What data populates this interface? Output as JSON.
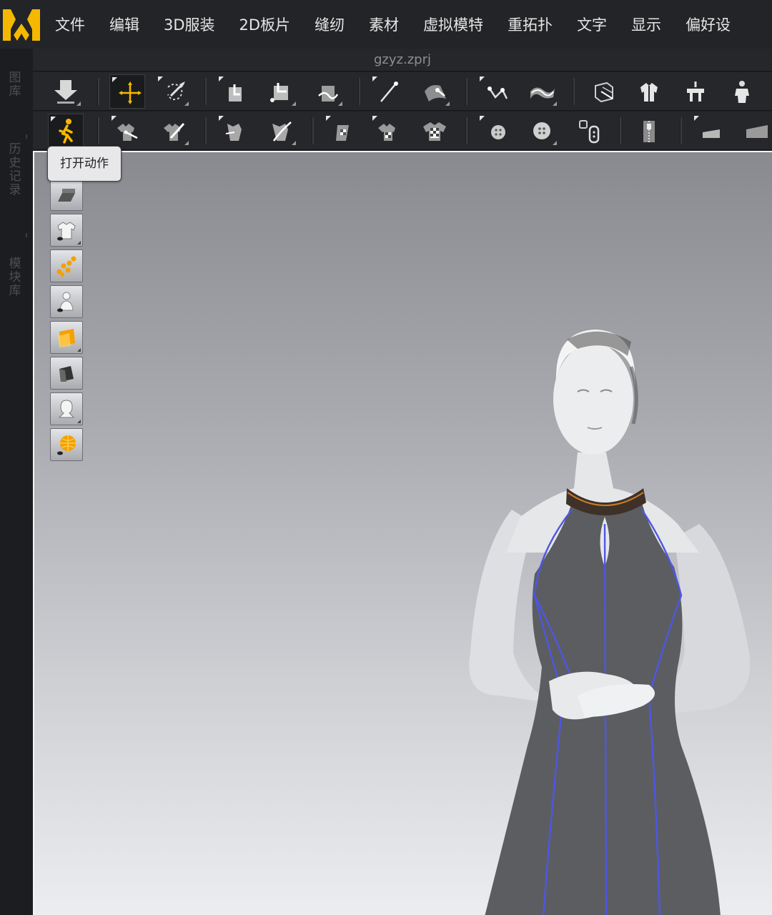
{
  "app": {
    "logo_icon": "marvelous-designer-logo-icon",
    "accent_color": "#f5b800",
    "file_name": "gzyz.zprj"
  },
  "menu": [
    {
      "label": "文件"
    },
    {
      "label": "编辑"
    },
    {
      "label": "3D服装"
    },
    {
      "label": "2D板片"
    },
    {
      "label": "缝纫"
    },
    {
      "label": "素材"
    },
    {
      "label": "虚拟模特"
    },
    {
      "label": "重拓扑"
    },
    {
      "label": "文字"
    },
    {
      "label": "显示"
    },
    {
      "label": "偏好设"
    }
  ],
  "side_tabs": [
    {
      "label": "图库"
    },
    {
      "label": "历史记录"
    },
    {
      "label": "模块库"
    }
  ],
  "toolbar_1": [
    {
      "icon": "import-arrow-icon"
    },
    {
      "icon": "select-move-icon",
      "active": true
    },
    {
      "icon": "select-mesh-icon"
    },
    {
      "icon": "fold-arrangement-icon"
    },
    {
      "icon": "fold-fabric-icon"
    },
    {
      "icon": "tack-icon"
    },
    {
      "icon": "pin-icon"
    },
    {
      "icon": "strap-icon"
    },
    {
      "icon": "measure-icon"
    },
    {
      "icon": "tape-icon"
    },
    {
      "icon": "avatar-box-icon"
    },
    {
      "icon": "garment-fit-icon"
    },
    {
      "icon": "hanger-icon"
    },
    {
      "icon": "avatar-icon"
    }
  ],
  "toolbar_2": [
    {
      "icon": "open-motion-icon"
    },
    {
      "icon": "edit-texture-icon"
    },
    {
      "icon": "pen-texture-icon"
    },
    {
      "icon": "edit-graphic-icon"
    },
    {
      "icon": "draw-graphic-icon"
    },
    {
      "icon": "flag-texture-icon"
    },
    {
      "icon": "checker-shirt-icon"
    },
    {
      "icon": "checker-tshirt-icon"
    },
    {
      "icon": "select-button-icon"
    },
    {
      "icon": "button-icon"
    },
    {
      "icon": "buttonhole-icon"
    },
    {
      "icon": "zipper-icon"
    },
    {
      "icon": "puckering-icon"
    },
    {
      "icon": "fabric-flat-icon"
    }
  ],
  "tooltip": {
    "text": "打开动作"
  },
  "viewport_tools": [
    {
      "icon": "display-grid-icon"
    },
    {
      "icon": "show-garment-icon"
    },
    {
      "icon": "show-points-icon"
    },
    {
      "icon": "show-avatar-icon"
    },
    {
      "icon": "texture-surface-icon"
    },
    {
      "icon": "fabric-mesh-icon"
    },
    {
      "icon": "avatar-silhouette-icon"
    },
    {
      "icon": "environment-icon"
    }
  ],
  "colors": {
    "dress": "#5a5b5e",
    "seam_line": "#4d56e6",
    "collar": "#3a2e24",
    "avatar": "#e4e5e7"
  }
}
